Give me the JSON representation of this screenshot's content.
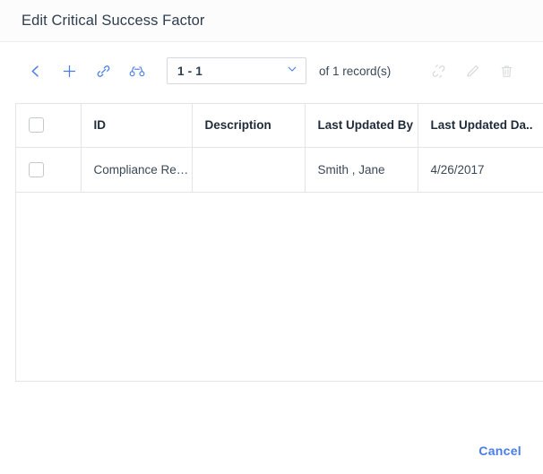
{
  "dialog": {
    "title": "Edit Critical Success Factor"
  },
  "toolbar": {
    "back_label": "back-chevron",
    "add_label": "add",
    "link_label": "link",
    "search_label": "find",
    "unlink_label": "unlink",
    "edit_label": "edit",
    "delete_label": "delete",
    "record_range": "1 - 1",
    "record_count_text": "of 1  record(s)",
    "dropdown_icon": "chevron-down-icon"
  },
  "grid": {
    "columns": [
      {
        "key": "check",
        "label": ""
      },
      {
        "key": "id",
        "label": "ID"
      },
      {
        "key": "description",
        "label": "Description"
      },
      {
        "key": "last_updated_by",
        "label": "Last Updated By"
      },
      {
        "key": "last_updated_date",
        "label": "Last Updated Da.."
      }
    ],
    "rows": [
      {
        "id": "Compliance Repo...",
        "description": "",
        "last_updated_by": "Smith , Jane",
        "last_updated_date": "4/26/2017"
      }
    ]
  },
  "footer": {
    "cancel_label": "Cancel"
  },
  "colors": {
    "accent": "#4a7ce8",
    "disabled_icon": "#d7dadd",
    "border": "#e3e5e8",
    "text": "#3a4857",
    "heading": "#1f2b38"
  }
}
